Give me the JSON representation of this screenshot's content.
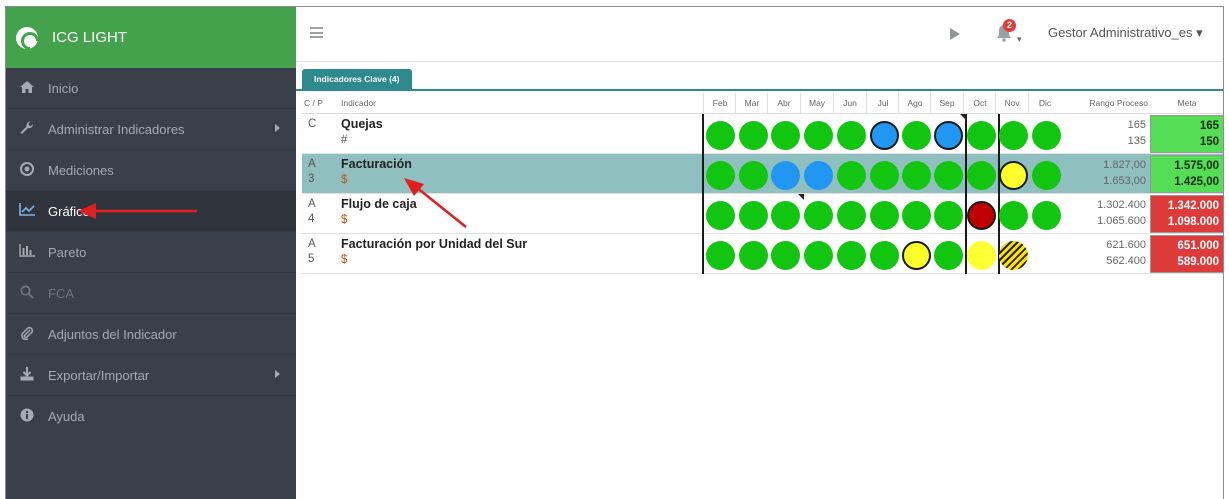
{
  "brand": {
    "name": "ICG LIGHT"
  },
  "sidebar": {
    "items": [
      {
        "label": "Inicio",
        "icon": "home-icon"
      },
      {
        "label": "Administrar Indicadores",
        "icon": "wrench-icon",
        "has_submenu": true
      },
      {
        "label": "Mediciones",
        "icon": "target-icon"
      },
      {
        "label": "Gráfico",
        "icon": "line-chart-icon",
        "active": true
      },
      {
        "label": "Pareto",
        "icon": "bar-chart-icon"
      },
      {
        "label": "FCA",
        "icon": "search-icon",
        "disabled": true
      },
      {
        "label": "Adjuntos del Indicador",
        "icon": "paperclip-icon"
      },
      {
        "label": "Exportar/Importar",
        "icon": "download-icon",
        "has_submenu": true
      },
      {
        "label": "Ayuda",
        "icon": "info-icon"
      }
    ]
  },
  "topbar": {
    "notifications_count": "2",
    "user": "Gestor Administrativo_es ▾"
  },
  "tab": {
    "label": "Indicadores Clave (4)"
  },
  "table": {
    "headers": {
      "cp": "C / P",
      "indicator": "Indicador",
      "months": [
        "Feb",
        "Mar",
        "Abr",
        "May",
        "Jun",
        "Jul",
        "Ago",
        "Sep",
        "Oct",
        "Nov",
        "Dic"
      ],
      "range": "Rango Proceso",
      "goal": "Meta"
    },
    "rows": [
      {
        "cp_line1": "C",
        "cp_line2": "",
        "name": "Quejas",
        "unit": "#",
        "statuses": [
          "green",
          "green",
          "green",
          "green",
          "green",
          "blue-ring",
          "green",
          "blue-ring",
          "green",
          "green",
          "green"
        ],
        "range_high": "165",
        "range_low": "135",
        "goal_high": "165",
        "goal_low": "150",
        "goal_color": "green"
      },
      {
        "cp_line1": "A",
        "cp_line2": "3",
        "name": "Facturación",
        "unit": "$",
        "statuses": [
          "green",
          "green",
          "blue",
          "blue",
          "green",
          "green",
          "green",
          "green",
          "green",
          "yellow",
          "green"
        ],
        "range_high": "1.827,00",
        "range_low": "1.653,00",
        "goal_high": "1.575,00",
        "goal_low": "1.425,00",
        "goal_color": "green"
      },
      {
        "cp_line1": "A",
        "cp_line2": "4",
        "name": "Flujo de caja",
        "unit": "$",
        "statuses": [
          "green",
          "green",
          "green",
          "green",
          "green",
          "green",
          "green",
          "green",
          "red",
          "green",
          "green"
        ],
        "range_high": "1.302.400",
        "range_low": "1.065.600",
        "goal_high": "1.342.000",
        "goal_low": "1.098.000",
        "goal_color": "red"
      },
      {
        "cp_line1": "A",
        "cp_line2": "5",
        "name": "Facturación por Unidad del Sur",
        "unit": "$",
        "statuses": [
          "green",
          "green",
          "green",
          "green",
          "green",
          "green",
          "yellow",
          "green",
          "yellow-plain",
          "hatch",
          "none"
        ],
        "range_high": "621.600",
        "range_low": "562.400",
        "goal_high": "651.000",
        "goal_low": "589.000",
        "goal_color": "red"
      }
    ]
  },
  "colors": {
    "brand_green": "#43a24b",
    "sidebar_bg": "#3a4049",
    "tab_teal": "#2f8a8f",
    "selected_row": "#8fbfbf",
    "status_green": "#11c511",
    "status_blue": "#2196f3",
    "status_yellow": "#ffff2a",
    "status_red": "#c00000",
    "arrow_red": "#e0201e"
  }
}
